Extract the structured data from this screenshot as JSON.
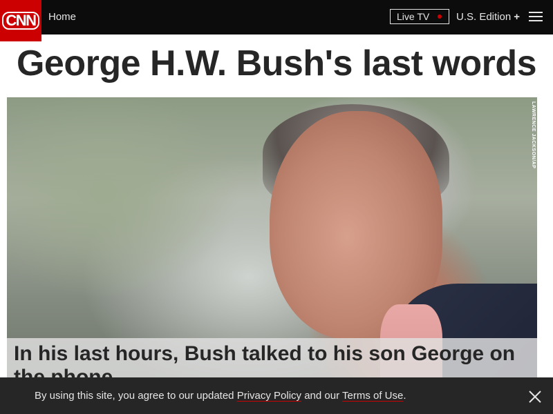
{
  "header": {
    "logo_text": "CNN",
    "home_label": "Home",
    "live_tv_label": "Live TV",
    "live_dot_color": "#cc0000",
    "edition_label": "U.S. Edition",
    "edition_plus": "+",
    "menu_icon": "hamburger-menu-icon"
  },
  "article": {
    "headline": "George H.W. Bush's last words",
    "photo_credit": "LAWRENCE JACKSON/AP",
    "hero_caption": "In his last hours, Bush talked to his son George on the phone"
  },
  "cookie_notice": {
    "text_before": "By using this site, you agree to our updated ",
    "privacy_link": "Privacy Policy",
    "text_middle": " and our ",
    "terms_link": "Terms of Use",
    "text_after": ".",
    "close_icon": "close-icon"
  },
  "colors": {
    "brand_red": "#cc0000",
    "header_bg": "#0c0c0c",
    "cookie_bg": "#262626"
  }
}
